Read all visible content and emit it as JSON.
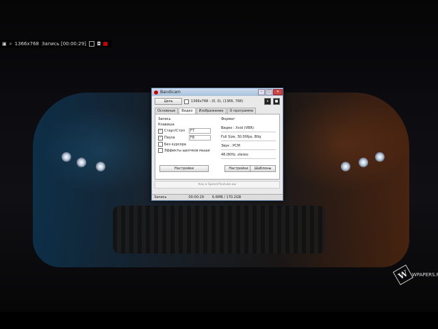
{
  "recorder_overlay": {
    "resolution": "1366x768",
    "record_label": "Запись [00:00:29]"
  },
  "watermark": {
    "badge": "W",
    "text": "WPAPERS.RU"
  },
  "window": {
    "title": "Bandicam",
    "toolbar": {
      "target_label": "Цель",
      "region_text": "1366x768 - (0, 0), (1366, 768)",
      "pause_icon": "⏸",
      "stop_icon": "■"
    },
    "tabs": [
      {
        "label": "Основные"
      },
      {
        "label": "Видео"
      },
      {
        "label": "Изображение"
      },
      {
        "label": "О программе"
      }
    ],
    "record": {
      "section_label": "Запись",
      "hotkey_label": "Клавиша",
      "hotkeys": [
        {
          "name": "Старт/Стоп",
          "key": "F7",
          "checked": true
        },
        {
          "name": "Пауза",
          "key": "F8",
          "checked": true
        }
      ],
      "no_cursor_label": "Без курсора",
      "cursor_effects_label": "Эффекты щелчков мыши",
      "settings_button": "Настройки"
    },
    "format": {
      "section_label": "Формат",
      "video_label": "Видео : Xvid (VBR)",
      "video_detail": "Full Size, 30.00fps, 80q",
      "audio_label": "Звук : PCM",
      "audio_detail": "48.0KHz, stereo",
      "settings_button": "Настройки",
      "templates_button": "Шаблоны"
    },
    "hint": "Как в Speed/Youtube.вы",
    "status": {
      "label": "Запись",
      "time": "00:00:29",
      "size": "6.6MB / 170.2GB"
    }
  },
  "colors": {
    "title_accent": "#c00000",
    "window_border": "#6a8ab0"
  }
}
